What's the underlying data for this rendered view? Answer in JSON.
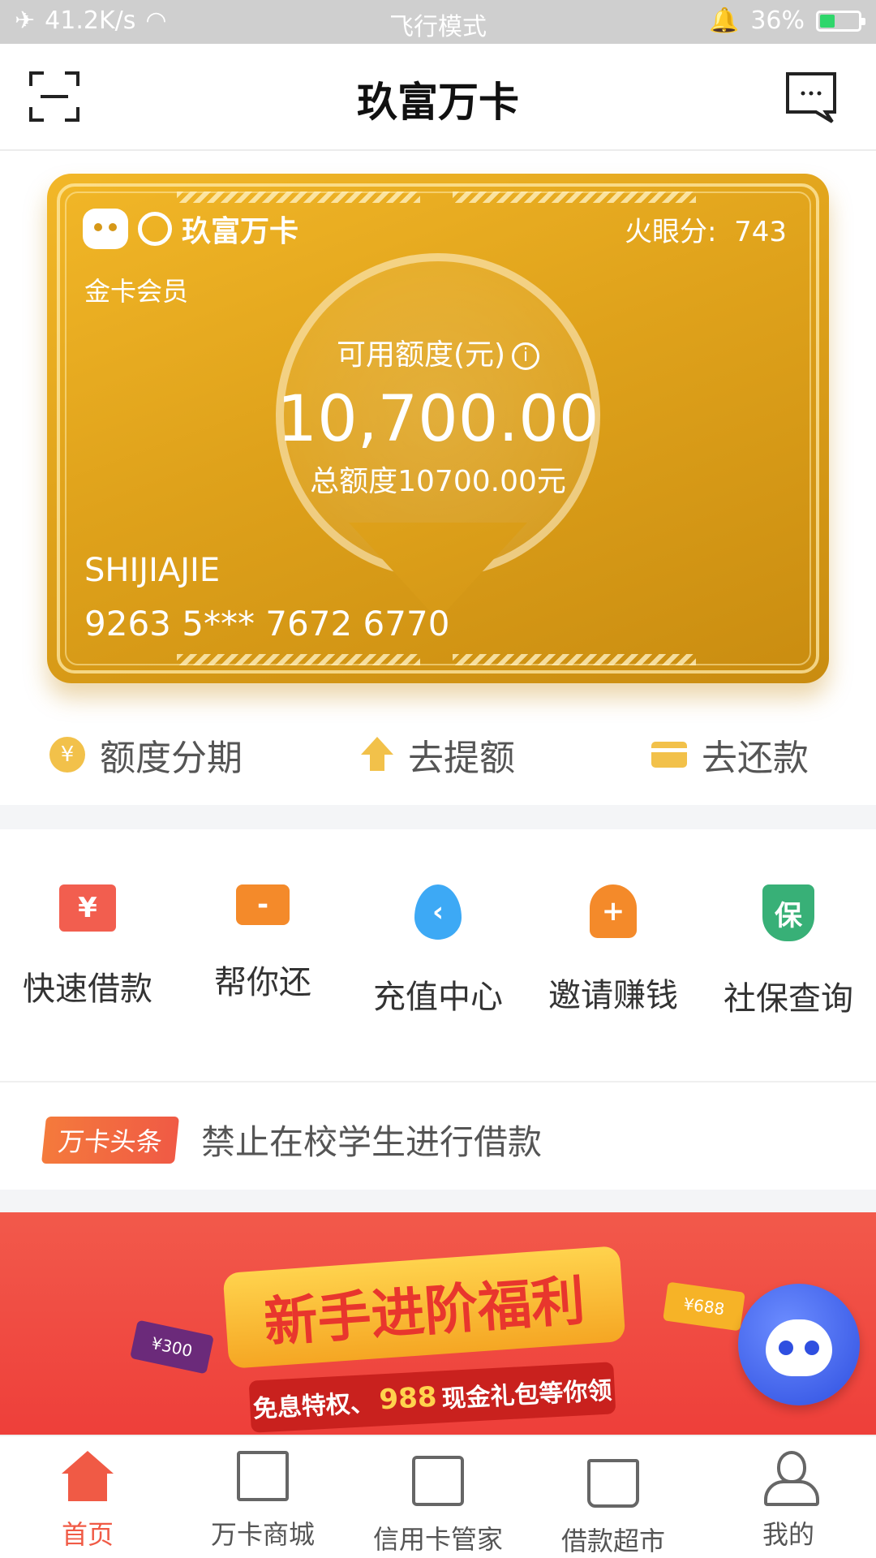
{
  "status_bar": {
    "network_speed": "41.2K/s",
    "mode": "飞行模式",
    "battery": "36%",
    "battery_level": 0.36
  },
  "header": {
    "title": "玖富万卡",
    "left_icon": "scan-icon",
    "right_icon": "message-icon"
  },
  "card": {
    "brand": "玖富万卡",
    "score_label": "火眼分:",
    "score_value": "743",
    "level": "金卡会员",
    "available_label": "可用额度(元)",
    "available_value": "10,700.00",
    "total_text": "总额度10700.00元",
    "holder": "SHIJIAJIE",
    "card_number": "9263 5*** 7672 6770"
  },
  "quick_actions": [
    {
      "label": "额度分期",
      "icon": "yen-circle-icon"
    },
    {
      "label": "去提额",
      "icon": "up-arrow-icon"
    },
    {
      "label": "去还款",
      "icon": "card-icon"
    }
  ],
  "services": [
    {
      "label": "快速借款",
      "icon": "yen-note-icon",
      "glyph": "¥"
    },
    {
      "label": "帮你还",
      "icon": "card-hand-icon",
      "glyph": "-"
    },
    {
      "label": "充值中心",
      "icon": "water-drop-icon",
      "glyph": "‹"
    },
    {
      "label": "邀请赚钱",
      "icon": "invite-user-icon",
      "glyph": "+"
    },
    {
      "label": "社保查询",
      "icon": "shield-icon",
      "glyph": "保"
    }
  ],
  "news": {
    "badge": "万卡头条",
    "text": "禁止在校学生进行借款"
  },
  "banner": {
    "title": "新手进阶福利",
    "sub_prefix": "免息特权、",
    "sub_number": "988",
    "sub_suffix": "现金礼包等你领",
    "coupon_left": "¥300",
    "coupon_right": "¥688"
  },
  "tabs": [
    {
      "label": "首页",
      "icon": "home-icon",
      "active": true
    },
    {
      "label": "万卡商城",
      "icon": "shopping-bag-icon",
      "active": false
    },
    {
      "label": "信用卡管家",
      "icon": "wallet-icon",
      "active": false
    },
    {
      "label": "借款超市",
      "icon": "basket-icon",
      "active": false
    },
    {
      "label": "我的",
      "icon": "user-icon",
      "active": false
    }
  ]
}
